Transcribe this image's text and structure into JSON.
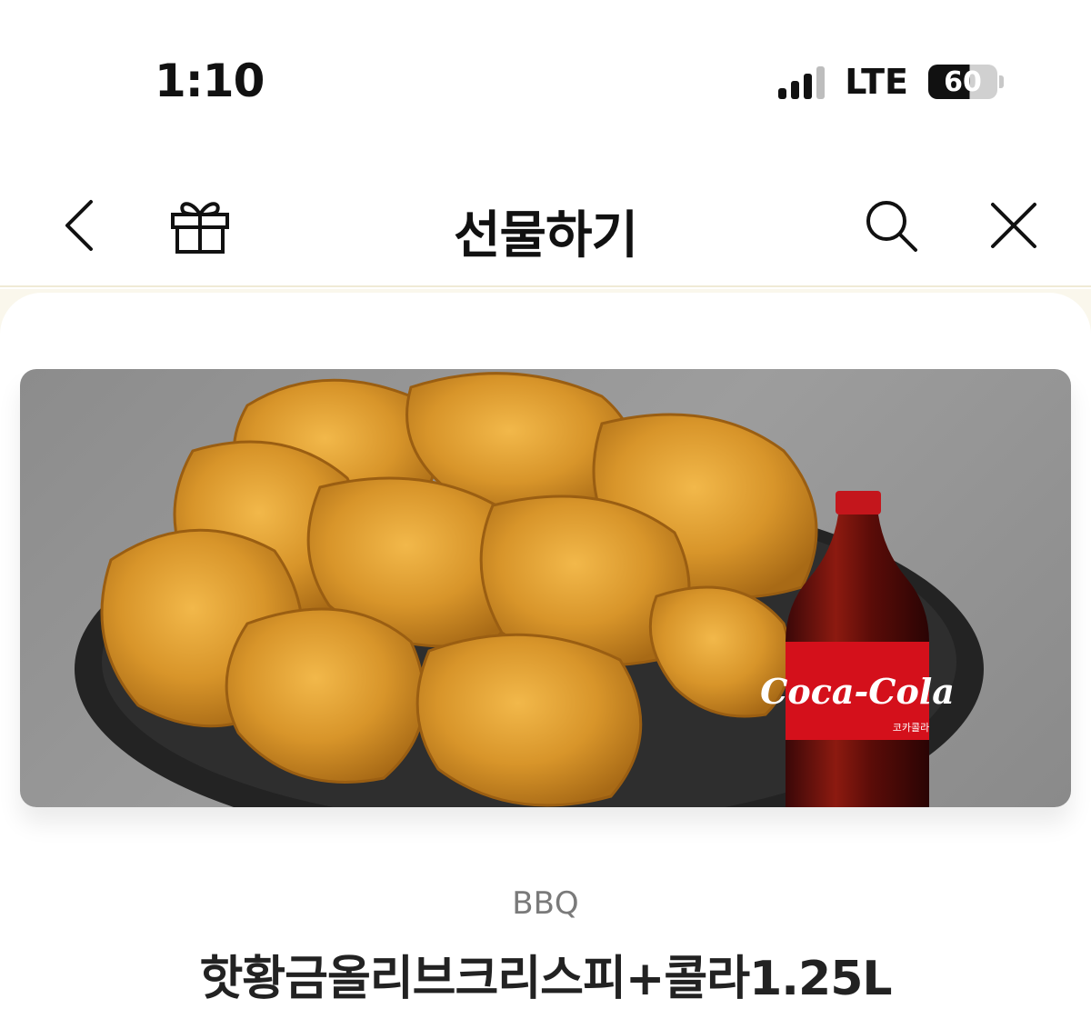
{
  "status_bar": {
    "time": "1:10",
    "network": "LTE",
    "battery": "60"
  },
  "nav": {
    "title": "선물하기",
    "icons": [
      "chevron-left-icon",
      "gift-icon",
      "search-icon",
      "close-icon"
    ]
  },
  "product": {
    "brand": "BBQ",
    "name": "핫황금올리브크리스피+콜라1.25L",
    "image": {
      "cola_logo": "Coca-Cola",
      "cola_label_small": "코카콜라"
    }
  },
  "colors": {
    "background_tint": "#faf7ec",
    "brand_text": "#7a7a7a",
    "cola_red": "#d4101b"
  }
}
